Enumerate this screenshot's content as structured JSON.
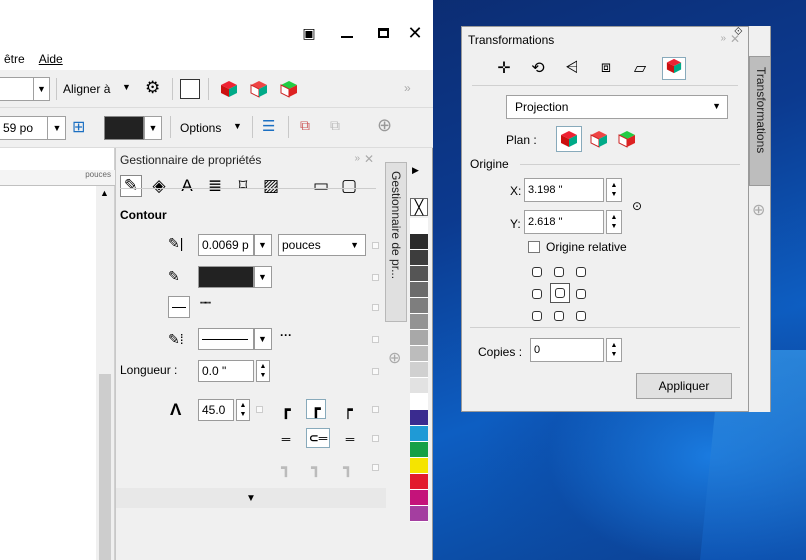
{
  "window": {
    "menu": [
      "être",
      "Aide"
    ]
  },
  "toolbar1": {
    "align_label": "Aligner à",
    "overflow": "»"
  },
  "toolbar2": {
    "size_value": "59 po",
    "options_label": "Options"
  },
  "ruler": {
    "unit": "pouces"
  },
  "properties": {
    "title": "Gestionnaire de propriétés",
    "section": "Contour",
    "width_value": "0.0069 p",
    "units_value": "pouces",
    "length_label": "Longueur :",
    "length_value": "0.0 \"",
    "miter_value": "45.0",
    "dock_tab_label": "Gestionnaire de pr..."
  },
  "palette": [
    "#ffffff",
    "#2b2b2b",
    "#3d3d3d",
    "#555555",
    "#6b6b6b",
    "#7e7e7e",
    "#939393",
    "#a8a8a8",
    "#bcbcbc",
    "#d0d0d0",
    "#e2e2e2",
    "#ffffff",
    "#3a2b8f",
    "#1f9ad6",
    "#16a046",
    "#f5e400",
    "#e21b2d",
    "#c4137a",
    "#a43ea0"
  ],
  "transformations": {
    "title": "Transformations",
    "mode": "Projection",
    "plan_label": "Plan :",
    "origin_label": "Origine",
    "x_label": "X:",
    "x_value": "3.198 \"",
    "y_label": "Y:",
    "y_value": "2.618 \"",
    "relative_label": "Origine relative",
    "copies_label": "Copies :",
    "copies_value": "0",
    "apply_label": "Appliquer",
    "side_tab_label": "Transformations"
  }
}
